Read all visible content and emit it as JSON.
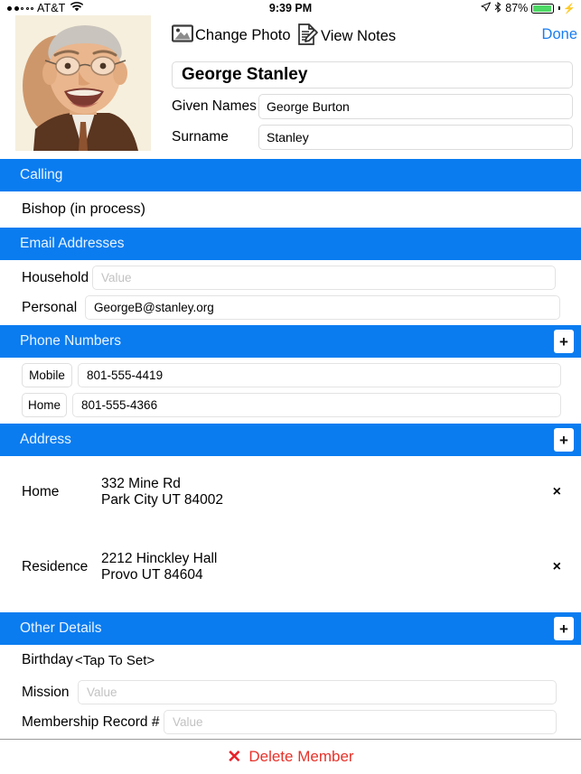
{
  "status_bar": {
    "signal_dots": 5,
    "signal_filled": 2,
    "carrier": "AT&T",
    "wifi_icon": "wifi-icon",
    "time": "9:39 PM",
    "location_icon": "location-arrow-icon",
    "bluetooth_icon": "bluetooth-icon",
    "battery_percent": "87%",
    "battery_level": 87,
    "battery_color": "#4cd964",
    "charging_icon": "charging-bolt-icon"
  },
  "toolbar": {
    "change_photo_label": "Change Photo",
    "change_photo_icon": "photo-icon",
    "view_notes_label": "View Notes",
    "view_notes_icon": "notes-pencil-icon",
    "done_label": "Done",
    "done_color": "#1a7df0"
  },
  "profile": {
    "photo_alt": "member-portrait",
    "display_name": "George Stanley",
    "given_names_label": "Given Names",
    "given_names_value": "George Burton",
    "surname_label": "Surname",
    "surname_value": "Stanley"
  },
  "theme": {
    "section_blue": "#0a7cf0",
    "section_text": "#eaf4ff",
    "delete_red": "#e8322a"
  },
  "sections": {
    "calling": {
      "title": "Calling",
      "value": "Bishop (in process)"
    },
    "email": {
      "title": "Email Addresses",
      "rows": [
        {
          "label": "Household",
          "value": "",
          "placeholder": "Value"
        },
        {
          "label": "Personal",
          "value": "GeorgeB@stanley.org",
          "placeholder": "Value"
        }
      ]
    },
    "phone": {
      "title": "Phone Numbers",
      "add_label": "+",
      "rows": [
        {
          "type": "Mobile",
          "number": "801-555-4419"
        },
        {
          "type": "Home",
          "number": "801-555-4366"
        }
      ]
    },
    "address": {
      "title": "Address",
      "add_label": "+",
      "rows": [
        {
          "label": "Home",
          "line1": "332 Mine Rd",
          "line2": "Park City UT 84002",
          "remove_label": "×"
        },
        {
          "label": "Residence",
          "line1": "2212 Hinckley Hall",
          "line2": "Provo UT 84604",
          "remove_label": "×"
        }
      ]
    },
    "other": {
      "title": "Other Details",
      "add_label": "+",
      "birthday_label": "Birthday",
      "birthday_value": "<Tap To Set>",
      "mission_label": "Mission",
      "mission_placeholder": "Value",
      "mission_value": "",
      "membership_label": "Membership Record #",
      "membership_placeholder": "Value",
      "membership_value": ""
    }
  },
  "footer": {
    "delete_icon": "x-mark-icon",
    "delete_label": "Delete Member"
  }
}
